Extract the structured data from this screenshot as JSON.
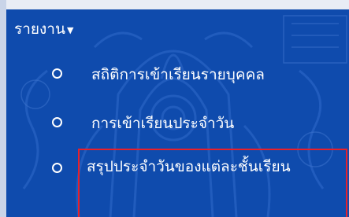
{
  "menu": {
    "header_label": "รายงาน",
    "items": [
      {
        "label": "สถิติการเข้าเรียนรายบุคคล"
      },
      {
        "label": "การเข้าเรียนประจำวัน"
      },
      {
        "label": "สรุปประจำวันของแต่ละชั้นเรียน"
      }
    ]
  },
  "colors": {
    "background": "#0f4bad",
    "text": "#ffffff",
    "highlight_border": "#e8202a"
  }
}
